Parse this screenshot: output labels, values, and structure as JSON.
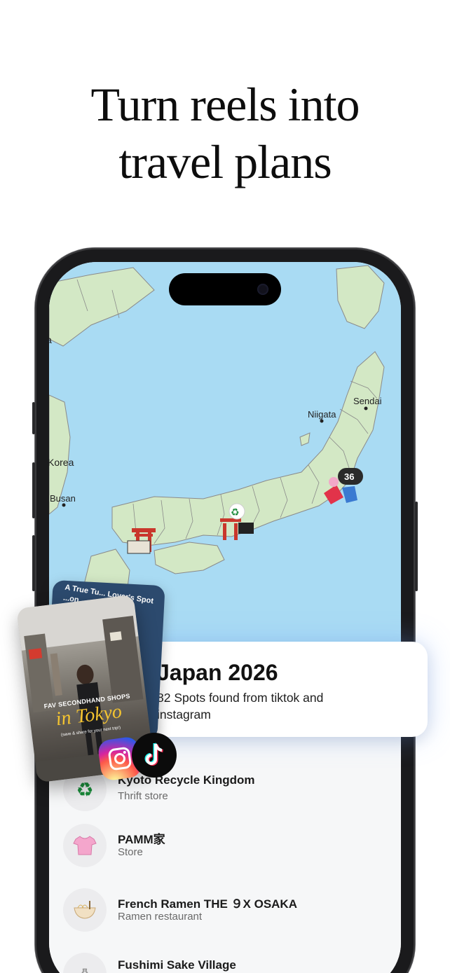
{
  "headline": {
    "line1": "Turn reels into",
    "line2": "travel plans"
  },
  "map": {
    "labels": {
      "niigata": "Niigata",
      "sendai": "Sendai",
      "korea": "Korea",
      "busan": "Busan",
      "edge_a": "a"
    },
    "cluster_count": "36",
    "colors": {
      "sea": "#a9dbf3",
      "land": "#d3e8c5",
      "border": "#7a7a7a"
    }
  },
  "card": {
    "title": "Japan 2026",
    "subtitle": "82 Spots found from tiktok and instagram"
  },
  "reel": {
    "back_text": "A True Tu... Lover's Spot ...on",
    "caption_top": "FAV SECONDHAND SHOPS",
    "caption_main": "in Tokyo",
    "caption_small": "(save & share for your next trip!)"
  },
  "list": {
    "items": [
      {
        "name": "Kyoto Recycle Kingdom",
        "category": "Thrift store",
        "icon": "recycle-icon"
      },
      {
        "name": "PAMM家",
        "category": "Store",
        "icon": "shirt-icon"
      },
      {
        "name": "French Ramen THE ９X OSAKA",
        "category": "Ramen restaurant",
        "icon": "ramen-icon"
      },
      {
        "name": "Fushimi Sake Village",
        "category": "",
        "icon": "sake-icon"
      }
    ]
  },
  "badges": [
    "instagram-icon",
    "tiktok-icon"
  ]
}
